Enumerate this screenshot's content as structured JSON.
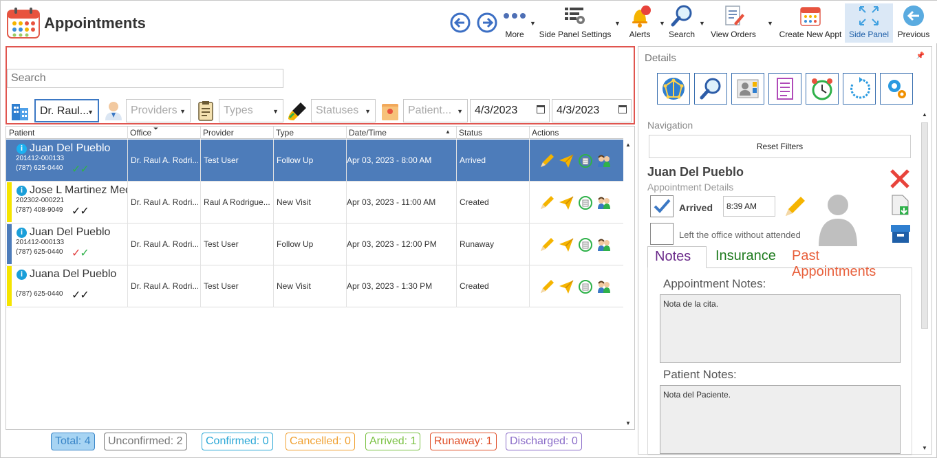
{
  "header": {
    "title": "Appointments",
    "toolbar": [
      {
        "label": "More"
      },
      {
        "label": "Side Panel Settings"
      },
      {
        "label": "Alerts"
      },
      {
        "label": "Search"
      },
      {
        "label": "View Orders"
      },
      {
        "label": "Create New Appt"
      },
      {
        "label": "Side Panel"
      },
      {
        "label": "Previous"
      }
    ]
  },
  "filters": {
    "search_placeholder": "Search",
    "office": "Dr. Raul...",
    "providers": "Providers",
    "types": "Types",
    "statuses": "Statuses",
    "patient": "Patient...",
    "date_from": "4/3/2023",
    "date_to": "4/3/2023"
  },
  "grid": {
    "columns": [
      "Patient",
      "Office",
      "Provider",
      "Type",
      "Date/Time",
      "Status",
      "Actions"
    ],
    "rows": [
      {
        "name": "Juan Del Pueblo",
        "id": "201412-000133",
        "phone": "(787) 625-0440",
        "office": "Dr. Raul A. Rodri...",
        "provider": "Test User",
        "type": "Follow Up",
        "datetime": "Apr 03, 2023 - 8:00 AM",
        "status": "Arrived",
        "mark_color": "#4d7cba",
        "checks": "✓✓",
        "check1_color": "#2fb14a",
        "check2_color": "#2fb14a"
      },
      {
        "name": "Jose L Martinez Med",
        "id": "202302-000221",
        "phone": "(787) 408-9049",
        "office": "Dr. Raul A. Rodri...",
        "provider": "Raul A Rodrigue...",
        "type": "New Visit",
        "datetime": "Apr 03, 2023 - 11:00 AM",
        "status": "Created",
        "mark_color": "#f5e400",
        "checks": "✓✓",
        "check1_color": "#111111",
        "check2_color": "#111111"
      },
      {
        "name": "Juan Del Pueblo",
        "id": "201412-000133",
        "phone": "(787) 625-0440",
        "office": "Dr. Raul A. Rodri...",
        "provider": "Test User",
        "type": "Follow Up",
        "datetime": "Apr 03, 2023 - 12:00 PM",
        "status": "Runaway",
        "mark_color": "#4d7cba",
        "checks": "✓✓",
        "check1_color": "#e03b3b",
        "check2_color": "#2fb14a"
      },
      {
        "name": "Juana Del Pueblo",
        "id": "",
        "phone": "(787) 625-0440",
        "office": "Dr. Raul A. Rodri...",
        "provider": "Test User",
        "type": "New Visit",
        "datetime": "Apr 03, 2023 - 1:30 PM",
        "status": "Created",
        "mark_color": "#f5e400",
        "checks": "✓✓",
        "check1_color": "#111111",
        "check2_color": "#111111"
      }
    ]
  },
  "counters": [
    {
      "label": "Total: 4",
      "color": "#3a86c8",
      "bg": "#a7d4f3"
    },
    {
      "label": "Unconfirmed: 2",
      "color": "#777777",
      "bg": "#ffffff"
    },
    {
      "label": "Confirmed: 0",
      "color": "#2aa7d6",
      "bg": "#ffffff"
    },
    {
      "label": "Cancelled: 0",
      "color": "#f0a030",
      "bg": "#ffffff"
    },
    {
      "label": "Arrived: 1",
      "color": "#7ac143",
      "bg": "#ffffff"
    },
    {
      "label": "Runaway: 1",
      "color": "#e0502a",
      "bg": "#ffffff"
    },
    {
      "label": "Discharged: 0",
      "color": "#8a6cc8",
      "bg": "#ffffff"
    }
  ],
  "details": {
    "title": "Details",
    "navigation_label": "Navigation",
    "reset_filters": "Reset Filters",
    "patient_name": "Juan Del Pueblo",
    "subtitle": "Appointment Details",
    "arrived_label": "Arrived",
    "arrived_time": "8:39 AM",
    "left_office_label": "Left the office without attended",
    "tabs": [
      {
        "label": "Notes",
        "color": "#6a2a8a"
      },
      {
        "label": "Insurance",
        "color": "#1e7b1e"
      },
      {
        "label": "Past Appointments",
        "color": "#e8603c"
      }
    ],
    "appointment_notes_label": "Appointment Notes:",
    "appointment_notes": "Nota de la cita.",
    "patient_notes_label": "Patient Notes:",
    "patient_notes": "Nota del Paciente."
  }
}
